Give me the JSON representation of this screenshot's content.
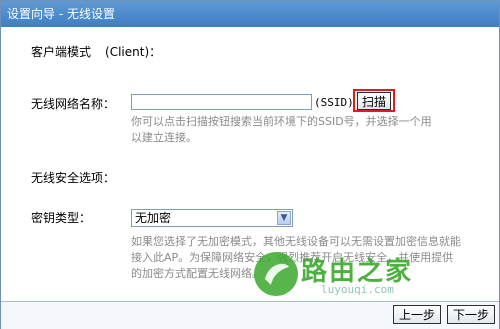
{
  "window": {
    "title": "设置向导 - 无线设置"
  },
  "mode": {
    "label": "客户端模式",
    "client": "(Client)："
  },
  "ssid": {
    "label": "无线网络名称：",
    "value": "",
    "suffix": "(SSID)",
    "scan_label": "扫描",
    "hint": "你可以点击扫描按钮搜索当前环境下的SSID号，并选择一个用以建立连接。"
  },
  "security": {
    "label": "无线安全选项："
  },
  "key_type": {
    "label": "密钥类型：",
    "selected": "无加密",
    "hint": "如果您选择了无加密模式，其他无线设备可以无需设置加密信息就能接入此AP。为保障网络安全，强烈推荐开启无线安全，并使用提供的加密方式配置无线网络。"
  },
  "buttons": {
    "prev": "上一步",
    "next": "下一步"
  },
  "watermark": {
    "text": "路由之家",
    "url": "luyouqi.com"
  }
}
